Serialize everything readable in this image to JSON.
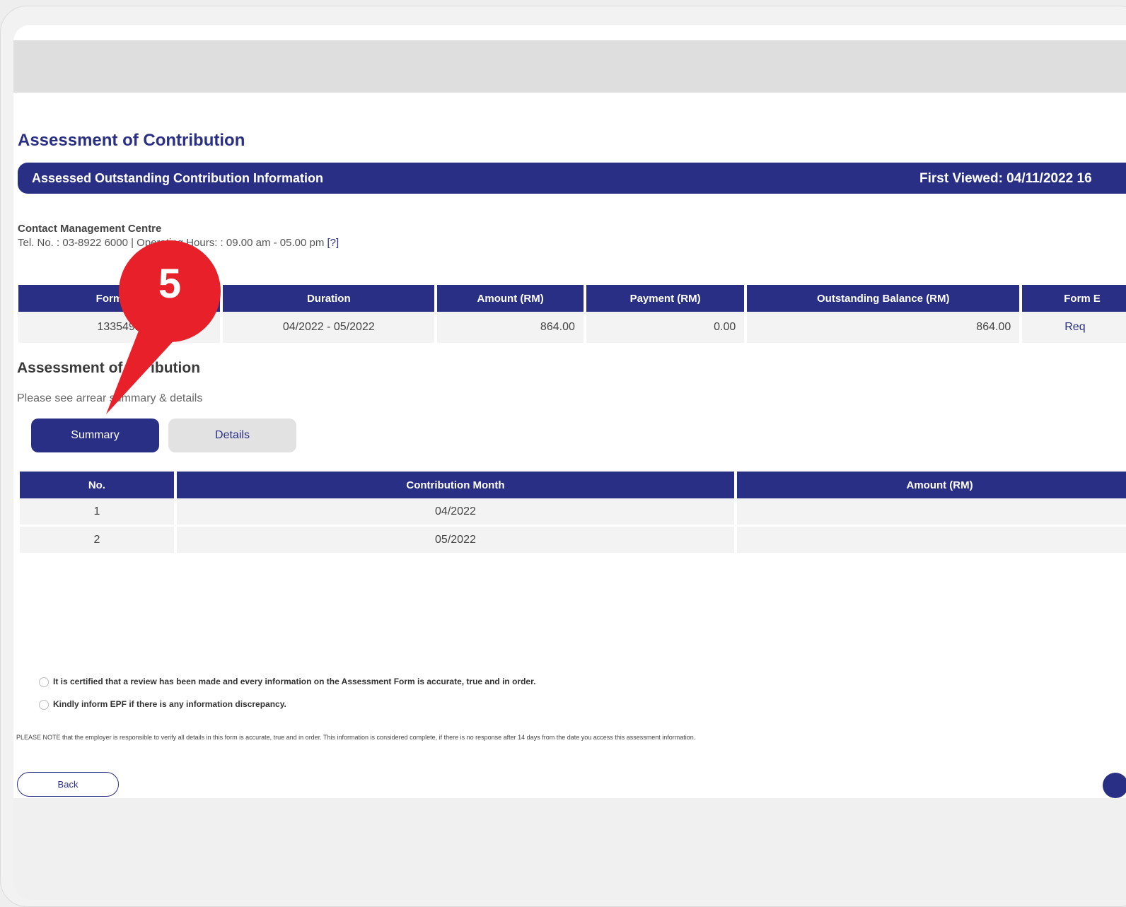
{
  "page": {
    "title": "Assessment of Contribution",
    "banner_title": "Assessed Outstanding Contribution Information",
    "first_viewed": "First Viewed: 04/11/2022 16"
  },
  "contact": {
    "title": "Contact Management Centre",
    "line": "Tel. No. : 03-8922 6000 | Operating Hours: : 09.00 am - 05.00 pm ",
    "help": "[?]"
  },
  "summary_table": {
    "headers": [
      "Form E S",
      "Duration",
      "Amount (RM)",
      "Payment (RM)",
      "Outstanding Balance (RM)",
      "Form E"
    ],
    "row": [
      "1335491",
      "04/2022 - 05/2022",
      "864.00",
      "0.00",
      "864.00",
      "Req"
    ]
  },
  "section": {
    "title": "Assessment of Co      ibution",
    "subtitle": "Please see arrear   summary & details"
  },
  "tabs": {
    "summary": "Summary",
    "details": "Details"
  },
  "detail_table": {
    "headers": [
      "No.",
      "Contribution Month",
      "Amount (RM)"
    ],
    "rows": [
      [
        "1",
        "04/2022",
        ""
      ],
      [
        "2",
        "05/2022",
        ""
      ]
    ]
  },
  "declarations": {
    "item1": "It is certified that a review has been made and every information on the Assessment Form is accurate, true and in order.",
    "item2": "Kindly inform EPF if there is any information discrepancy."
  },
  "note": "PLEASE NOTE that the employer is responsible to verify all details in this form is accurate, true and in order. This information is considered complete, if there is no response after 14 days from the date you access this assessment information.",
  "buttons": {
    "back": "Back"
  },
  "callout": {
    "number": "5",
    "color": "#e8202a"
  },
  "colors": {
    "primary": "#2a2f86",
    "accent": "#e8202a"
  }
}
